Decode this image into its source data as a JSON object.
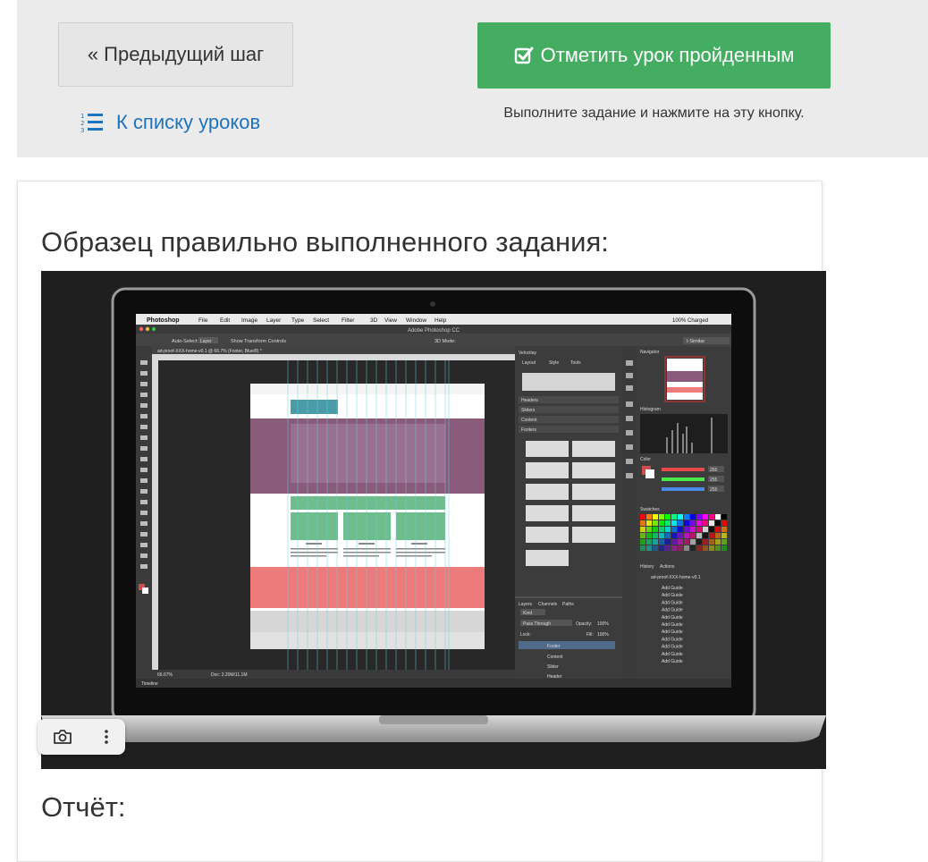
{
  "nav": {
    "prev_label": "« Предыдущий шаг",
    "lessons_label": "К списку уроков",
    "done_label": "Отметить урок пройденным",
    "hint": "Выполните задание и нажмите на эту кнопку."
  },
  "card": {
    "sample_title": "Образец правильно выполненного задания:",
    "report_title": "Отчёт:"
  },
  "screenshot": {
    "app_name": "Photoshop",
    "menu": [
      "File",
      "Edit",
      "Image",
      "Layer",
      "Type",
      "Select",
      "Filter",
      "3D",
      "View",
      "Window",
      "Help"
    ],
    "window_title": "Adobe Photoshop CC",
    "status_battery": "100% Charged",
    "doc_tab": "ad-proof-XXX-home-v0.1 @ 66.7% (Footer, Blue/8) *",
    "zoom": "66.67%",
    "doc_info": "Doc: 3.20M/11.1M",
    "workspace": "I-Similar",
    "timeline": "Timeline",
    "panel_tabs": [
      "Velocitay",
      "Layout",
      "Style",
      "Tools"
    ],
    "velocity_sections": [
      "Headers",
      "Sliders",
      "Content",
      "Footers"
    ],
    "layers_tabs": [
      "Layers",
      "Channels",
      "Paths"
    ],
    "layers_blend": "Pass Through",
    "layers_opacity_label": "Opacity:",
    "layers_opacity": "100%",
    "layers_fill_label": "Fill:",
    "layers_fill": "100%",
    "layers_kind": "Kind",
    "layers_lock": "Lock:",
    "layers": [
      "Footer",
      "Content",
      "Slider",
      "Header"
    ],
    "navigator": "Navigator",
    "histogram": "Histogram",
    "color": "Color",
    "color_r": "255",
    "color_g": "255",
    "color_b": "255",
    "swatches": "Swatches",
    "history_tabs": [
      "History",
      "Actions"
    ],
    "history_first": "ad-proof-XXX-home-v0.1",
    "history_item": "Add Guide",
    "auto_select": "Auto-Select:",
    "auto_select_value": "Layer",
    "transform": "Show Transform Controls",
    "mode_3d": "3D Mode:",
    "card_titles": [
      "ANCHOR A",
      "ANCHOR A",
      "ANCHOR A"
    ],
    "footer_text": "More info here | contact info"
  },
  "colors": {
    "green": "#44ad62",
    "link": "#1e73be",
    "purple_band": "#8a5a7a",
    "teal_box": "#4a9ba8",
    "green_box": "#6fbd8c",
    "salmon_band": "#ee7b7b"
  }
}
